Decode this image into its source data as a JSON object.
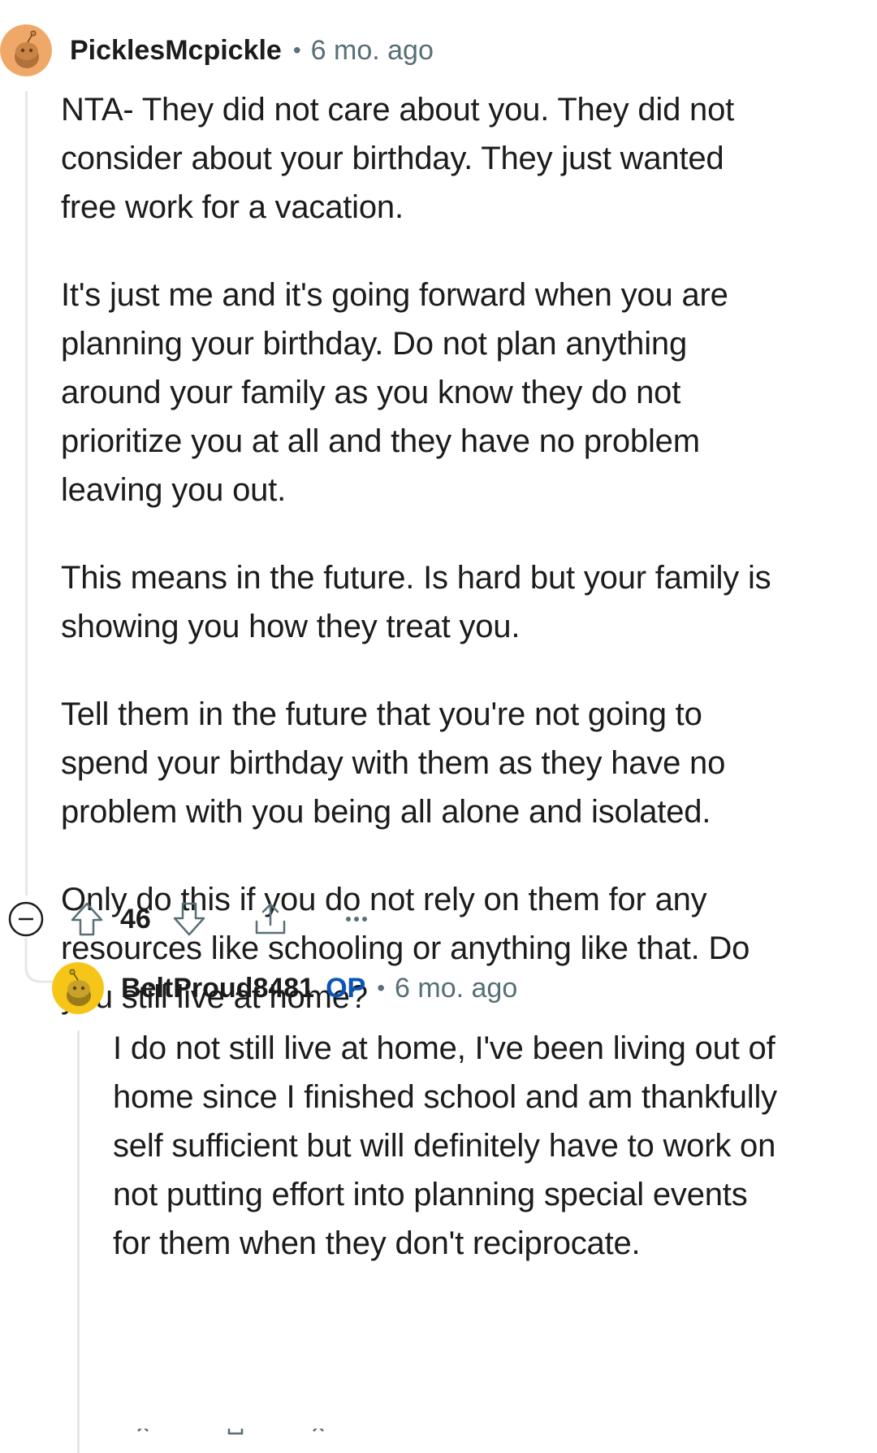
{
  "comment": {
    "username": "PicklesMcpickle",
    "separator": "•",
    "age": "6 mo. ago",
    "paragraphs": [
      "NTA- They did not care about you. They did not consider about your birthday. They just wanted free work for a vacation.",
      "It's just me and it's going forward when you are planning your birthday. Do not plan anything around your family as you know they do not prioritize you at all and they have no problem leaving you out.",
      "This means in the future. Is hard but your family is showing you how they treat you.",
      "Tell them in the future that you're not going to spend your birthday with them as they have no problem with you being all alone and isolated.",
      "Only do this if you do not rely on them for any resources like schooling or anything like that. Do you still live at home?"
    ],
    "vote_count": "46",
    "avatar_color": "#f0a868"
  },
  "reply": {
    "username": "BeltProud8481",
    "op_badge": "OP",
    "separator": "•",
    "age": "6 mo. ago",
    "paragraphs": [
      "I do not still live at home, I've been living out of home since I finished school and am thankfully self sufficient but will definitely have to work on not putting effort into planning special events for them when they don't reciprocate."
    ],
    "avatar_color": "#f5c518"
  },
  "icons": {
    "collapse": "collapse-minus-icon",
    "upvote": "upvote-arrow-icon",
    "downvote": "downvote-arrow-icon",
    "share": "share-icon",
    "more": "more-options-icon"
  },
  "colors": {
    "text": "#1c1c1c",
    "meta": "#576f76",
    "op": "#0a56b8",
    "thread_line": "#e5e7e9"
  }
}
